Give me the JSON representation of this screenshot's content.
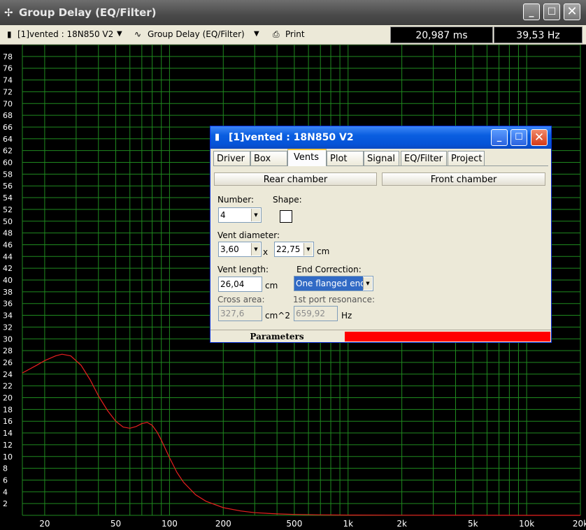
{
  "window": {
    "title": "Group Delay (EQ/Filter)"
  },
  "toolbar": {
    "driver_select": "[1]vented : 18N850 V2",
    "plot_select": "Group Delay (EQ/Filter)",
    "print_label": "Print",
    "readout_time": "20,987 ms",
    "readout_freq": "39,53 Hz"
  },
  "chart_data": {
    "type": "line",
    "x_scale": "log",
    "xlim": [
      15,
      20000
    ],
    "ylim": [
      0,
      80
    ],
    "x_ticks": [
      {
        "value": 20,
        "label": "20"
      },
      {
        "value": 50,
        "label": "50"
      },
      {
        "value": 100,
        "label": "100"
      },
      {
        "value": 200,
        "label": "200"
      },
      {
        "value": 500,
        "label": "500"
      },
      {
        "value": 1000,
        "label": "1k"
      },
      {
        "value": 2000,
        "label": "2k"
      },
      {
        "value": 5000,
        "label": "5k"
      },
      {
        "value": 10000,
        "label": "10k"
      },
      {
        "value": 20000,
        "label": "20k"
      }
    ],
    "y_ticks": [
      2,
      4,
      6,
      8,
      10,
      12,
      14,
      16,
      18,
      20,
      22,
      24,
      26,
      28,
      30,
      32,
      34,
      36,
      38,
      40,
      42,
      44,
      46,
      48,
      50,
      52,
      54,
      56,
      58,
      60,
      62,
      64,
      66,
      68,
      70,
      72,
      74,
      76,
      78
    ],
    "grid": true,
    "colors": {
      "background": "#000000",
      "grid": "#1f8a1f",
      "line": "#e8201f",
      "labels": "#ffffff"
    },
    "series": [
      {
        "x": [
          15,
          18,
          20,
          23,
          25,
          28,
          32,
          36,
          40,
          45,
          50,
          55,
          60,
          65,
          70,
          75,
          80,
          85,
          90,
          100,
          110,
          120,
          140,
          160,
          200,
          250,
          300,
          400,
          500,
          700,
          1000,
          2000,
          5000,
          10000,
          20000
        ],
        "y": [
          24.2,
          25.5,
          26.3,
          27.1,
          27.4,
          27.1,
          25.5,
          23.0,
          20.3,
          17.8,
          16.0,
          15.0,
          14.8,
          15.1,
          15.6,
          15.8,
          15.3,
          14.2,
          12.8,
          9.8,
          7.3,
          5.6,
          3.5,
          2.4,
          1.3,
          0.75,
          0.45,
          0.25,
          0.15,
          0.08,
          0.05,
          0.02,
          0.01,
          0.0,
          0.0
        ]
      }
    ]
  },
  "dialog": {
    "title": "[1]vented :  18N850 V2",
    "tabs": [
      "Driver",
      "Box",
      "Vents",
      "Plot",
      "Signal",
      "EQ/Filter",
      "Project"
    ],
    "active_tab": "Vents",
    "rear_chamber_label": "Rear chamber",
    "front_chamber_label": "Front chamber",
    "number_label": "Number:",
    "number_value": "4",
    "shape_label": "Shape:",
    "vent_diameter_label": "Vent diameter:",
    "diameter_value_1": "3,60",
    "diameter_x": "x",
    "diameter_value_2": "22,75",
    "diameter_unit": "cm",
    "vent_length_label": "Vent length:",
    "vent_length_value": "26,04",
    "vent_length_unit": "cm",
    "end_correction_label": "End Correction:",
    "end_correction_value": "One flanged end",
    "cross_area_label": "Cross area:",
    "cross_area_value": "327,6",
    "cross_area_unit": "cm^2",
    "port_resonance_label": "1st port resonance:",
    "port_resonance_value": "659,92",
    "port_resonance_unit": "Hz",
    "status_text": "Parameters",
    "status_bar_color": "#ff0000"
  }
}
